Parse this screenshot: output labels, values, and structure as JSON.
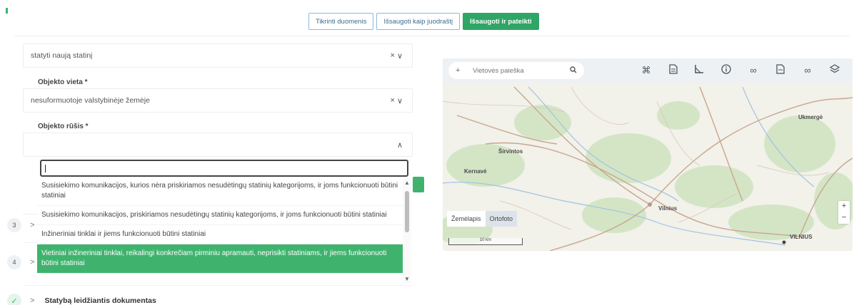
{
  "toolbar": {
    "btn1": "Tikrinti duomenis",
    "btn2": "Išsaugoti kaip juodraštį",
    "btn3": "Išsaugoti ir pateikti"
  },
  "form": {
    "first_select_value": "statyti naują statinį",
    "location_label": "Objekto vieta *",
    "location_value": "nesuformuotoje valstybinėje žemėje",
    "type_label": "Objekto rūšis *",
    "clear_glyph": "×",
    "chevron_down_glyph": "∨",
    "chevron_up_glyph": "∧"
  },
  "dropdown": {
    "search_value": "",
    "options": [
      "Susisiekimo komunikacijos, kurios nėra priskiriamos nesudėtingų statinių kategorijoms, ir joms funkcionuoti būtini statiniai",
      "Susisiekimo komunikacijos, priskiriamos nesudėtingų statinių kategorijoms, ir joms funkcionuoti būtini statiniai",
      "Inžineriniai tinklai ir jiems funkcionuoti būtini statiniai",
      "Vietiniai inžineriniai tinklai, reikalingi konkrečiam pirminiu apramauti, neprisikti statiniams, ir jiems funkcionuoti būtini statiniai"
    ]
  },
  "steps": [
    {
      "num": "3",
      "chevron": ">",
      "label": ""
    },
    {
      "num": "4",
      "chevron": ">",
      "label": ""
    },
    {
      "num": "✓",
      "chevron": ">",
      "label": "Statybą leidžiantis dokumentas"
    }
  ],
  "map": {
    "search_placeholder": "Vietovės paieška",
    "search_plus": "+",
    "layers": [
      "Žemėlapis",
      "Ortofoto"
    ],
    "scale_text": "10 km",
    "labels": [
      "Ukmergė",
      "Širvintos",
      "Vilnius",
      "VILNIUS",
      "Kernavė"
    ],
    "zoom_in": "+",
    "zoom_out": "−",
    "tool_icons": [
      "expand-icon",
      "document-icon",
      "measure-icon",
      "info-icon",
      "link-icon",
      "file-icon",
      "chain-icon",
      "layers-icon"
    ]
  },
  "colors": {
    "accent_green": "#2fa566",
    "selected_option": "#3fb36e",
    "outline_blue": "#8fb9d6"
  }
}
